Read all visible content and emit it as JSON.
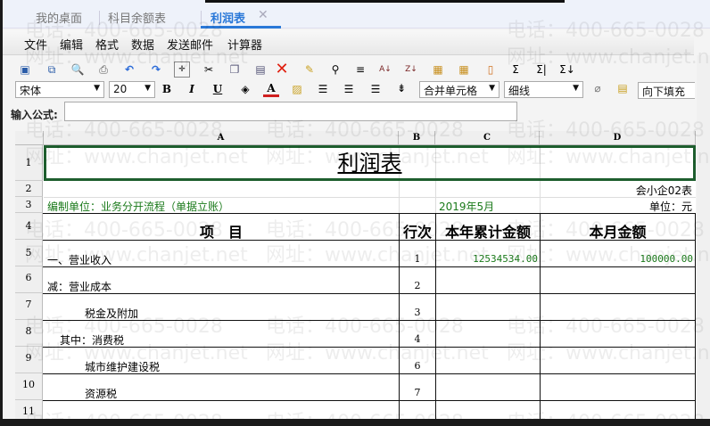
{
  "tabs": [
    {
      "label": "我的桌面"
    },
    {
      "label": "科目余额表"
    },
    {
      "label": "利润表",
      "active": true
    }
  ],
  "menu": [
    "文件",
    "编辑",
    "格式",
    "数据",
    "发送邮件",
    "计算器"
  ],
  "toolbar": {
    "font": "宋体",
    "size": "20",
    "merge": "合并单元格",
    "border": "细线",
    "fill": "向下填充",
    "bold": "B",
    "italic": "I",
    "underline": "U",
    "fontcolor": "A"
  },
  "formula": {
    "label": "输入公式:",
    "value": ""
  },
  "columns": [
    "A",
    "B",
    "C",
    "D"
  ],
  "rows": [
    "1",
    "2",
    "3",
    "4",
    "5",
    "6",
    "7",
    "8",
    "9",
    "10",
    "11"
  ],
  "sheet": {
    "title": "利润表",
    "form_no": "会小企02表",
    "company": "编制单位：业务分开流程（单据立账）",
    "period": "2019年5月",
    "unit": "单位：元",
    "headers": [
      "项　目",
      "行次",
      "本年累计金额",
      "本月金额"
    ],
    "lines": [
      {
        "item": "一、营业收入",
        "no": "1",
        "ytd": "12534534.00",
        "month": "100000.00"
      },
      {
        "item": "减：营业成本",
        "no": "2",
        "ytd": "",
        "month": ""
      },
      {
        "item": "税金及附加",
        "no": "3",
        "ytd": "",
        "month": ""
      },
      {
        "item": "其中：消费税",
        "no": "4",
        "ytd": "",
        "month": ""
      },
      {
        "item": "城市维护建设税",
        "no": "6",
        "ytd": "",
        "month": ""
      },
      {
        "item": "资源税",
        "no": "7",
        "ytd": "",
        "month": ""
      }
    ]
  },
  "watermark": {
    "phone": "电话：400-665-0028",
    "web": "网址：www.chanjet.net"
  },
  "colors": {
    "accent": "#2a78d8",
    "green": "#1a7a1a",
    "selection": "#1e5e2e"
  }
}
